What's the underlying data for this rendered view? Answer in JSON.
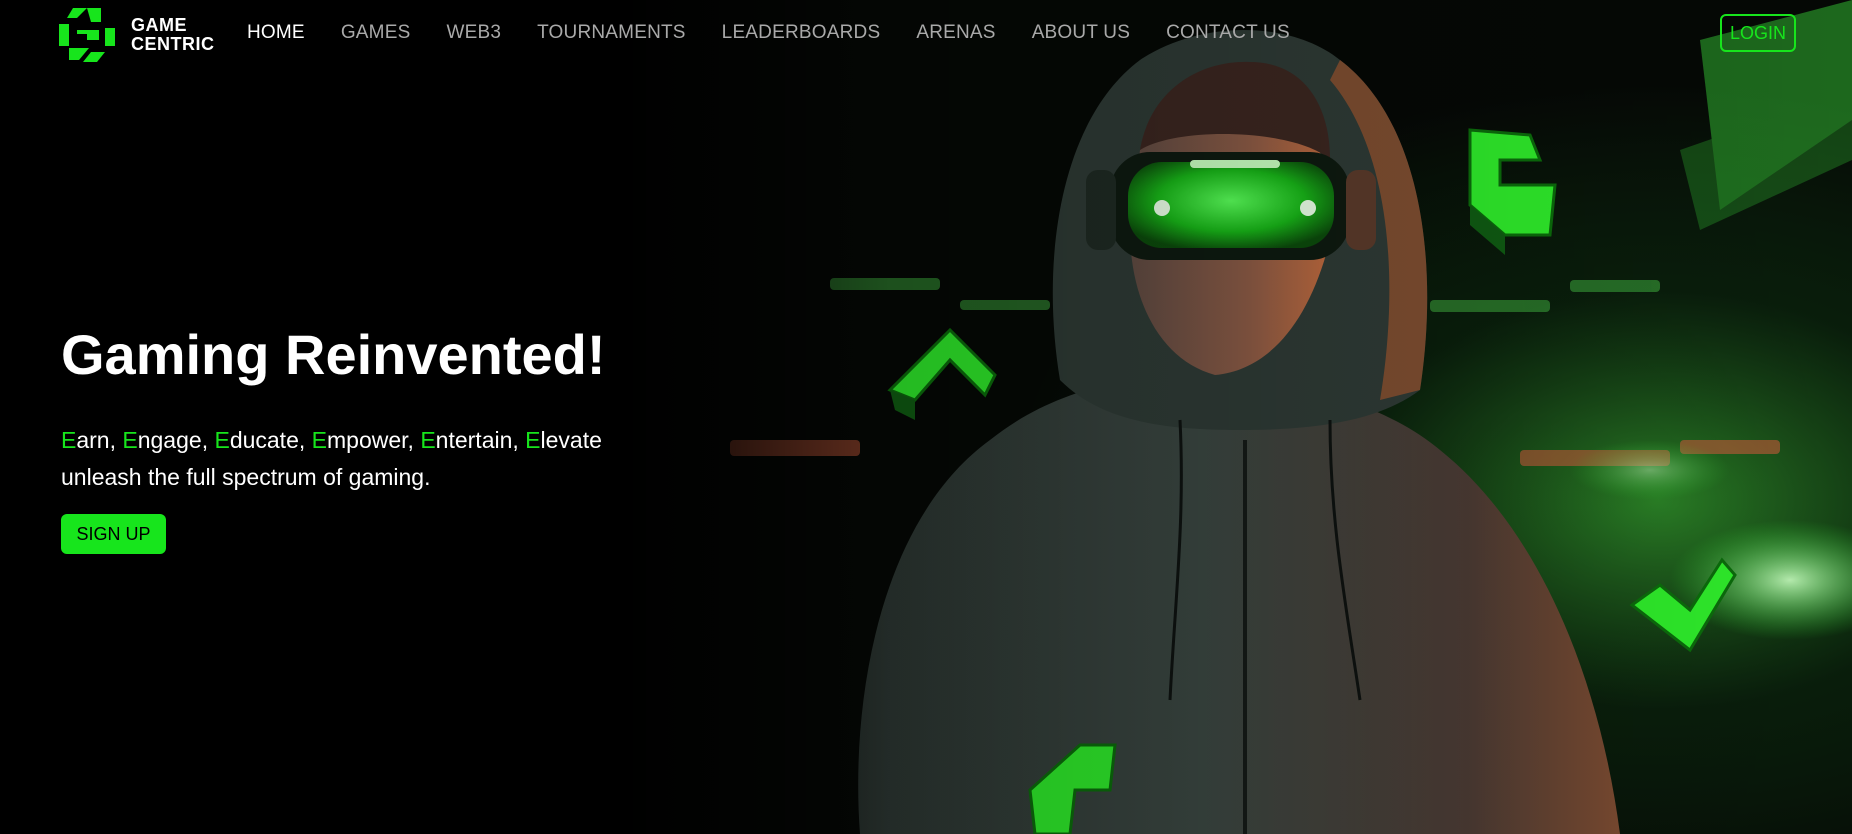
{
  "brand": {
    "name_line1": "GAME",
    "name_line2": "CENTRIC",
    "logo_icon": "game-centric-logo-icon",
    "accent_color": "#17e51c"
  },
  "nav": {
    "items": [
      {
        "label": "HOME",
        "active": true
      },
      {
        "label": "GAMES",
        "active": false
      },
      {
        "label": "WEB3",
        "active": false
      },
      {
        "label": "TOURNAMENTS",
        "active": false
      },
      {
        "label": "LEADERBOARDS",
        "active": false
      },
      {
        "label": "ARENAS",
        "active": false
      },
      {
        "label": "ABOUT US",
        "active": false
      },
      {
        "label": "CONTACT US",
        "active": false
      }
    ],
    "login_label": "LOGIN"
  },
  "hero": {
    "headline": "Gaming Reinvented!",
    "tagline_words": [
      {
        "initial": "E",
        "rest": "arn",
        "sep": ", "
      },
      {
        "initial": "E",
        "rest": "ngage",
        "sep": ", "
      },
      {
        "initial": "E",
        "rest": "ducate",
        "sep": ", "
      },
      {
        "initial": "E",
        "rest": "mpower",
        "sep": ", "
      },
      {
        "initial": "E",
        "rest": "ntertain",
        "sep": ", "
      },
      {
        "initial": "E",
        "rest": "levate",
        "sep": ""
      }
    ],
    "tagline_line2": "unleash the full spectrum of gaming.",
    "signup_label": "SIGN UP",
    "background_image": "gamer-in-hoodie-with-green-vr-goggles-in-arena"
  },
  "colors": {
    "background": "#000000",
    "accent": "#17e51c",
    "nav_inactive": "#a9a9a9",
    "nav_active": "#ffffff"
  }
}
